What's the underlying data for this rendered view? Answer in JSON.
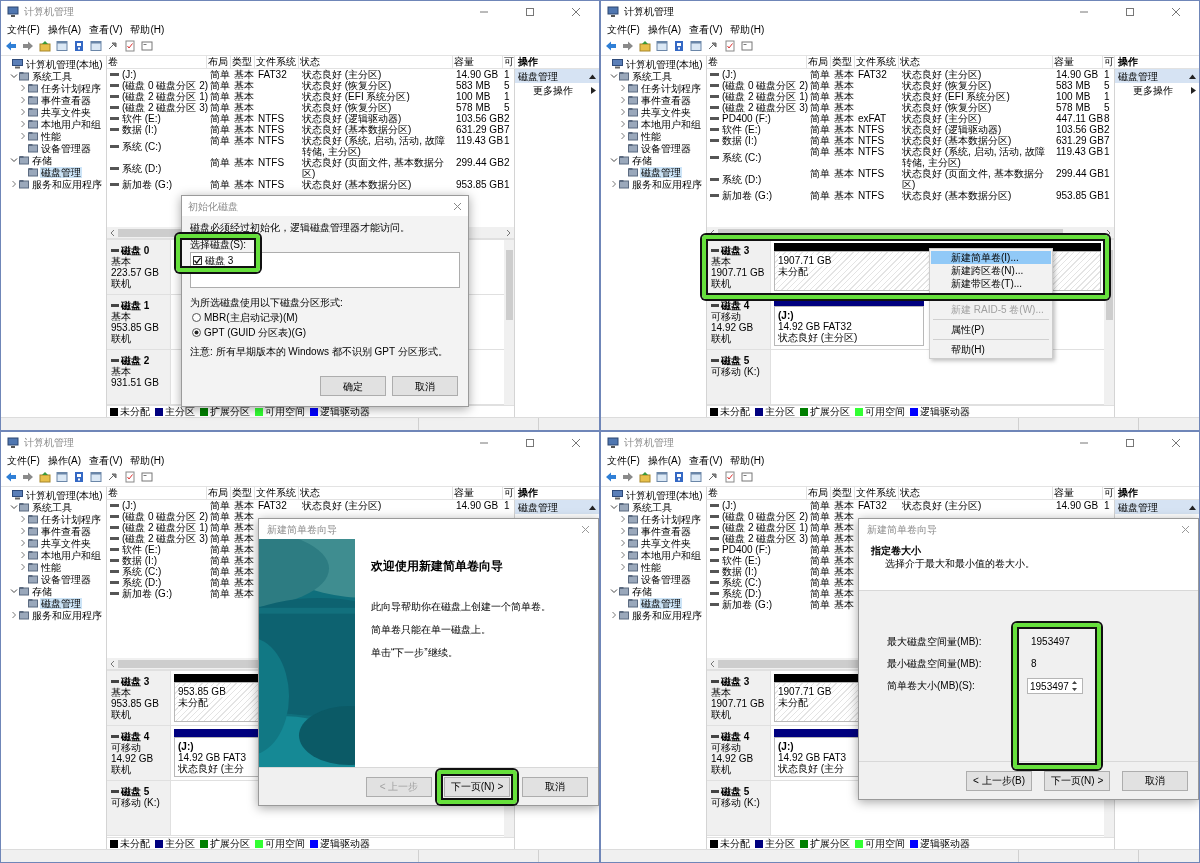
{
  "panels": [
    {
      "window": {
        "title": "计算机管理",
        "active": false
      },
      "menu": [
        "文件(F)",
        "操作(A)",
        "查看(V)",
        "帮助(H)"
      ],
      "tree": [
        {
          "label": "计算机管理(本地)",
          "selected": false,
          "children": [
            {
              "label": "系统工具",
              "expanded": true,
              "selected": false,
              "children": [
                {
                  "label": "任务计划程序",
                  "expanded": false,
                  "selected": false
                },
                {
                  "label": "事件查看器",
                  "expanded": false,
                  "selected": false
                },
                {
                  "label": "共享文件夹",
                  "expanded": false,
                  "selected": false
                },
                {
                  "label": "本地用户和组",
                  "expanded": false,
                  "selected": false
                },
                {
                  "label": "性能",
                  "expanded": false,
                  "selected": false
                },
                {
                  "label": "设备管理器",
                  "selected": false
                }
              ]
            },
            {
              "label": "存储",
              "expanded": true,
              "selected": false,
              "children": [
                {
                  "label": "磁盘管理",
                  "selected": true
                }
              ]
            },
            {
              "label": "服务和应用程序",
              "expanded": false,
              "selected": false
            }
          ]
        }
      ],
      "table": {
        "columns": [
          "卷",
          "布局",
          "类型",
          "文件系统",
          "状态",
          "容量",
          "可"
        ],
        "rows": [
          {
            "volume": "(J:)",
            "layout": "简单",
            "type": "基本",
            "file_system": "FAT32",
            "status": "状态良好 (主分区)",
            "capacity": "14.90 GB",
            "column_7": "1"
          },
          {
            "volume": "(磁盘 0 磁盘分区 2)",
            "layout": "简单",
            "type": "基本",
            "status": "状态良好 (恢复分区)",
            "capacity": "583 MB",
            "column_7": "5"
          },
          {
            "volume": "(磁盘 2 磁盘分区 1)",
            "layout": "简单",
            "type": "基本",
            "status": "状态良好 (EFI 系统分区)",
            "capacity": "100 MB",
            "column_7": "1"
          },
          {
            "volume": "(磁盘 2 磁盘分区 3)",
            "layout": "简单",
            "type": "基本",
            "status": "状态良好 (恢复分区)",
            "capacity": "578 MB",
            "column_7": "5"
          },
          {
            "volume": "软件 (E:)",
            "layout": "简单",
            "type": "基本",
            "file_system": "NTFS",
            "status": "状态良好 (逻辑驱动器)",
            "capacity": "103.56 GB",
            "column_7": "2"
          },
          {
            "volume": "数据 (I:)",
            "layout": "简单",
            "type": "基本",
            "file_system": "NTFS",
            "status": "状态良好 (基本数据分区)",
            "capacity": "631.29 GB",
            "column_7": "7"
          },
          {
            "volume": "系统 (C:)",
            "layout": "简单",
            "type": "基本",
            "file_system": "NTFS",
            "status": "状态良好 (系统, 启动, 活动, 故障转储, 主分区)",
            "capacity": "119.43 GB",
            "column_7": "1"
          },
          {
            "volume": "系统 (D:)",
            "layout": "简单",
            "type": "基本",
            "file_system": "NTFS",
            "status": "状态良好 (页面文件, 基本数据分区)",
            "capacity": "299.44 GB",
            "column_7": "2"
          },
          {
            "volume": "新加卷 (G:)",
            "layout": "简单",
            "type": "基本",
            "file_system": "NTFS",
            "status": "状态良好 (基本数据分区)",
            "capacity": "953.85 GB",
            "column_7": "1"
          }
        ]
      },
      "actions": {
        "title": "操作",
        "items": [
          {
            "label": "磁盘管理",
            "kind": "section"
          },
          {
            "label": "更多操作",
            "kind": "submenu"
          }
        ]
      },
      "disks": [
        {
          "name": "磁盘 0",
          "type": "基本",
          "size": "223.57 GB",
          "status": "联机"
        },
        {
          "name": "磁盘 1",
          "type": "基本",
          "size": "953.85 GB",
          "status": "联机"
        },
        {
          "name": "磁盘 2",
          "type": "基本",
          "size": "931.51 GB"
        }
      ],
      "legend": [
        {
          "label": "未分配",
          "color": "#000000"
        },
        {
          "label": "主分区",
          "color": "#00007f"
        },
        {
          "label": "扩展分区",
          "color": "#007f00"
        },
        {
          "label": "可用空间",
          "color": "#33ff33"
        },
        {
          "label": "逻辑驱动器",
          "color": "#0000ff"
        }
      ],
      "dialog": {
        "kind": "init_disk",
        "title": "初始化磁盘",
        "message": "磁盘必须经过初始化，逻辑磁盘管理器才能访问。",
        "disk_list_label": "选择磁盘(S):",
        "disk_list_highlighted": true,
        "disks": [
          {
            "label": "磁盘 3",
            "checked": true
          }
        ],
        "style_label": "为所选磁盘使用以下磁盘分区形式:",
        "styles": [
          {
            "label": "MBR(主启动记录)(M)",
            "selected": false
          },
          {
            "label": "GPT (GUID 分区表)(G)",
            "selected": true
          }
        ],
        "note": "注意: 所有早期版本的 Windows 都不识别 GPT 分区形式。",
        "buttons": [
          {
            "label": "确定",
            "disabled": false,
            "highlighted": false
          },
          {
            "label": "取消",
            "disabled": false,
            "highlighted": false
          }
        ]
      }
    },
    {
      "window": {
        "title": "计算机管理",
        "active": true
      },
      "menu": [
        "文件(F)",
        "操作(A)",
        "查看(V)",
        "帮助(H)"
      ],
      "tree": [
        {
          "label": "计算机管理(本地)",
          "selected": false,
          "children": [
            {
              "label": "系统工具",
              "expanded": true,
              "selected": false,
              "children": [
                {
                  "label": "任务计划程序",
                  "expanded": false,
                  "selected": false
                },
                {
                  "label": "事件查看器",
                  "expanded": false,
                  "selected": false
                },
                {
                  "label": "共享文件夹",
                  "expanded": false,
                  "selected": false
                },
                {
                  "label": "本地用户和组",
                  "expanded": false,
                  "selected": false
                },
                {
                  "label": "性能",
                  "expanded": false,
                  "selected": false
                },
                {
                  "label": "设备管理器",
                  "selected": false
                }
              ]
            },
            {
              "label": "存储",
              "expanded": true,
              "selected": false,
              "children": [
                {
                  "label": "磁盘管理",
                  "selected": true
                }
              ]
            },
            {
              "label": "服务和应用程序",
              "expanded": false,
              "selected": false
            }
          ]
        }
      ],
      "table": {
        "columns": [
          "卷",
          "布局",
          "类型",
          "文件系统",
          "状态",
          "容量",
          "可"
        ],
        "rows": [
          {
            "volume": "(J:)",
            "layout": "简单",
            "type": "基本",
            "file_system": "FAT32",
            "status": "状态良好 (主分区)",
            "capacity": "14.90 GB",
            "column_7": "1"
          },
          {
            "volume": "(磁盘 0 磁盘分区 2)",
            "layout": "简单",
            "type": "基本",
            "status": "状态良好 (恢复分区)",
            "capacity": "583 MB",
            "column_7": "5"
          },
          {
            "volume": "(磁盘 2 磁盘分区 1)",
            "layout": "简单",
            "type": "基本",
            "status": "状态良好 (EFI 系统分区)",
            "capacity": "100 MB",
            "column_7": "1"
          },
          {
            "volume": "(磁盘 2 磁盘分区 3)",
            "layout": "简单",
            "type": "基本",
            "status": "状态良好 (恢复分区)",
            "capacity": "578 MB",
            "column_7": "5"
          },
          {
            "volume": "PD400 (F:)",
            "layout": "简单",
            "type": "基本",
            "file_system": "exFAT",
            "status": "状态良好 (主分区)",
            "capacity": "447.11 GB",
            "column_7": "8"
          },
          {
            "volume": "软件 (E:)",
            "layout": "简单",
            "type": "基本",
            "file_system": "NTFS",
            "status": "状态良好 (逻辑驱动器)",
            "capacity": "103.56 GB",
            "column_7": "2"
          },
          {
            "volume": "数据 (I:)",
            "layout": "简单",
            "type": "基本",
            "file_system": "NTFS",
            "status": "状态良好 (基本数据分区)",
            "capacity": "631.29 GB",
            "column_7": "7"
          },
          {
            "volume": "系统 (C:)",
            "layout": "简单",
            "type": "基本",
            "file_system": "NTFS",
            "status": "状态良好 (系统, 启动, 活动, 故障转储, 主分区)",
            "capacity": "119.43 GB",
            "column_7": "1"
          },
          {
            "volume": "系统 (D:)",
            "layout": "简单",
            "type": "基本",
            "file_system": "NTFS",
            "status": "状态良好 (页面文件, 基本数据分区)",
            "capacity": "299.44 GB",
            "column_7": "1"
          },
          {
            "volume": "新加卷 (G:)",
            "layout": "简单",
            "type": "基本",
            "file_system": "NTFS",
            "status": "状态良好 (基本数据分区)",
            "capacity": "953.85 GB",
            "column_7": "1"
          }
        ]
      },
      "actions": {
        "title": "操作",
        "items": [
          {
            "label": "磁盘管理",
            "kind": "section"
          },
          {
            "label": "更多操作",
            "kind": "submenu"
          }
        ]
      },
      "disks": [
        {
          "name": "磁盘 3",
          "type": "基本",
          "size": "1907.71 GB",
          "status": "联机",
          "highlighted": true,
          "partitions": [
            {
              "kind": "unallocated",
              "size": "1907.71 GB",
              "status": "未分配"
            }
          ]
        },
        {
          "name": "磁盘 4",
          "type": "可移动",
          "size": "14.92 GB",
          "status": "联机",
          "highlighted": false,
          "partitions": [
            {
              "kind": "primary",
              "label": "(J:)",
              "size": "14.92 GB FAT32",
              "status": "状态良好 (主分区)"
            }
          ]
        },
        {
          "name": "磁盘 5",
          "type": "可移动 (K:)",
          "highlighted": false
        }
      ],
      "legend": [
        {
          "label": "未分配",
          "color": "#000000"
        },
        {
          "label": "主分区",
          "color": "#00007f"
        },
        {
          "label": "扩展分区",
          "color": "#007f00"
        },
        {
          "label": "可用空间",
          "color": "#33ff33"
        },
        {
          "label": "逻辑驱动器",
          "color": "#0000ff"
        }
      ],
      "dialog": {
        "kind": "context_menu",
        "groups": [
          [
            {
              "label": "新建简单卷(I)...",
              "selected": true,
              "disabled": false
            },
            {
              "label": "新建跨区卷(N)...",
              "selected": false,
              "disabled": false
            },
            {
              "label": "新建带区卷(T)...",
              "selected": false,
              "disabled": false
            },
            {
              "label": "新建 RAID-5 卷(W)...",
              "selected": false,
              "disabled": true
            }
          ],
          [
            {
              "label": "属性(P)",
              "selected": false,
              "disabled": false
            }
          ],
          [
            {
              "label": "帮助(H)",
              "selected": false,
              "disabled": false
            }
          ]
        ]
      }
    },
    {
      "window": {
        "title": "计算机管理",
        "active": false
      },
      "menu": [
        "文件(F)",
        "操作(A)",
        "查看(V)",
        "帮助(H)"
      ],
      "tree": [
        {
          "label": "计算机管理(本地)",
          "selected": false,
          "children": [
            {
              "label": "系统工具",
              "expanded": true,
              "selected": false,
              "children": [
                {
                  "label": "任务计划程序",
                  "expanded": false,
                  "selected": false
                },
                {
                  "label": "事件查看器",
                  "expanded": false,
                  "selected": false
                },
                {
                  "label": "共享文件夹",
                  "expanded": false,
                  "selected": false
                },
                {
                  "label": "本地用户和组",
                  "expanded": false,
                  "selected": false
                },
                {
                  "label": "性能",
                  "expanded": false,
                  "selected": false
                },
                {
                  "label": "设备管理器",
                  "selected": false
                }
              ]
            },
            {
              "label": "存储",
              "expanded": true,
              "selected": false,
              "children": [
                {
                  "label": "磁盘管理",
                  "selected": true
                }
              ]
            },
            {
              "label": "服务和应用程序",
              "expanded": false,
              "selected": false
            }
          ]
        }
      ],
      "table": {
        "columns": [
          "卷",
          "布局",
          "类型",
          "文件系统",
          "状态",
          "容量",
          "可"
        ],
        "rows": [
          {
            "volume": "(J:)",
            "layout": "简单",
            "type": "基本",
            "file_system": "FAT32",
            "status": "状态良好 (主分区)",
            "capacity": "14.90 GB",
            "column_7": "1"
          },
          {
            "volume": "(磁盘 0 磁盘分区 2)",
            "layout": "简单",
            "type": "基本"
          },
          {
            "volume": "(磁盘 2 磁盘分区 1)",
            "layout": "简单",
            "type": "基本"
          },
          {
            "volume": "(磁盘 2 磁盘分区 3)",
            "layout": "简单",
            "type": "基本"
          },
          {
            "volume": "软件 (E:)",
            "layout": "简单",
            "type": "基本"
          },
          {
            "volume": "数据 (I:)",
            "layout": "简单",
            "type": "基本"
          },
          {
            "volume": "系统 (C:)",
            "layout": "简单",
            "type": "基本"
          },
          {
            "volume": "系统 (D:)",
            "layout": "简单",
            "type": "基本"
          },
          {
            "volume": "新加卷 (G:)",
            "layout": "简单",
            "type": "基本"
          }
        ]
      },
      "actions": {
        "title": "操作",
        "items": [
          {
            "label": "磁盘管理",
            "kind": "section"
          }
        ]
      },
      "disks": [
        {
          "name": "磁盘 3",
          "type": "基本",
          "size": "953.85 GB",
          "status": "联机",
          "highlighted": false,
          "partitions": [
            {
              "kind": "unallocated",
              "size": "953.85 GB",
              "status": "未分配"
            }
          ]
        },
        {
          "name": "磁盘 4",
          "type": "可移动",
          "size": "14.92 GB",
          "status": "联机",
          "highlighted": false,
          "partitions": [
            {
              "kind": "primary",
              "label": "(J:)",
              "size": "14.92 GB FAT3",
              "status": "状态良好 (主分"
            }
          ]
        },
        {
          "name": "磁盘 5",
          "type": "可移动 (K:)",
          "highlighted": false
        }
      ],
      "legend": [
        {
          "label": "未分配",
          "color": "#000000"
        },
        {
          "label": "主分区",
          "color": "#00007f"
        },
        {
          "label": "扩展分区",
          "color": "#007f00"
        },
        {
          "label": "可用空间",
          "color": "#33ff33"
        },
        {
          "label": "逻辑驱动器",
          "color": "#0000ff"
        }
      ],
      "dialog": {
        "kind": "wizard_welcome",
        "title": "新建简单卷向导",
        "heading": "欢迎使用新建简单卷向导",
        "paragraphs": [
          "此向导帮助你在磁盘上创建一个简单卷。",
          "简单卷只能在单一磁盘上。",
          "单击“下一步”继续。"
        ],
        "buttons": [
          {
            "label": "< 上一步",
            "disabled": true,
            "highlighted": false
          },
          {
            "label": "下一页(N) >",
            "disabled": false,
            "highlighted": true
          },
          {
            "label": "取消",
            "disabled": false,
            "highlighted": false
          }
        ]
      }
    },
    {
      "window": {
        "title": "计算机管理",
        "active": false
      },
      "menu": [
        "文件(F)",
        "操作(A)",
        "查看(V)",
        "帮助(H)"
      ],
      "tree": [
        {
          "label": "计算机管理(本地)",
          "selected": false,
          "children": [
            {
              "label": "系统工具",
              "expanded": true,
              "selected": false,
              "children": [
                {
                  "label": "任务计划程序",
                  "expanded": false,
                  "selected": false
                },
                {
                  "label": "事件查看器",
                  "expanded": false,
                  "selected": false
                },
                {
                  "label": "共享文件夹",
                  "expanded": false,
                  "selected": false
                },
                {
                  "label": "本地用户和组",
                  "expanded": false,
                  "selected": false
                },
                {
                  "label": "性能",
                  "expanded": false,
                  "selected": false
                },
                {
                  "label": "设备管理器",
                  "selected": false
                }
              ]
            },
            {
              "label": "存储",
              "expanded": true,
              "selected": false,
              "children": [
                {
                  "label": "磁盘管理",
                  "selected": true
                }
              ]
            },
            {
              "label": "服务和应用程序",
              "expanded": false,
              "selected": false
            }
          ]
        }
      ],
      "table": {
        "columns": [
          "卷",
          "布局",
          "类型",
          "文件系统",
          "状态",
          "容量",
          "可"
        ],
        "rows": [
          {
            "volume": "(J:)",
            "layout": "简单",
            "type": "基本",
            "file_system": "FAT32",
            "status": "状态良好 (主分区)",
            "capacity": "14.90 GB",
            "column_7": "1"
          },
          {
            "volume": "(磁盘 0 磁盘分区 2)",
            "layout": "简单",
            "type": "基本"
          },
          {
            "volume": "(磁盘 2 磁盘分区 1)",
            "layout": "简单",
            "type": "基本"
          },
          {
            "volume": "(磁盘 2 磁盘分区 3)",
            "layout": "简单",
            "type": "基本"
          },
          {
            "volume": "PD400 (F:)",
            "layout": "简单",
            "type": "基本"
          },
          {
            "volume": "软件 (E:)",
            "layout": "简单",
            "type": "基本"
          },
          {
            "volume": "数据 (I:)",
            "layout": "简单",
            "type": "基本"
          },
          {
            "volume": "系统 (C:)",
            "layout": "简单",
            "type": "基本"
          },
          {
            "volume": "系统 (D:)",
            "layout": "简单",
            "type": "基本"
          },
          {
            "volume": "新加卷 (G:)",
            "layout": "简单",
            "type": "基本"
          }
        ]
      },
      "actions": {
        "title": "操作",
        "items": [
          {
            "label": "磁盘管理",
            "kind": "section"
          }
        ]
      },
      "disks": [
        {
          "name": "磁盘 3",
          "type": "基本",
          "size": "1907.71 GB",
          "status": "联机",
          "highlighted": false,
          "partitions": [
            {
              "kind": "unallocated",
              "size": "1907.71 GB",
              "status": "未分配"
            }
          ]
        },
        {
          "name": "磁盘 4",
          "type": "可移动",
          "size": "14.92 GB",
          "status": "联机",
          "highlighted": false,
          "partitions": [
            {
              "kind": "primary",
              "label": "(J:)",
              "size": "14.92 GB FAT3",
              "status": "状态良好 (主分"
            }
          ]
        },
        {
          "name": "磁盘 5",
          "type": "可移动 (K:)",
          "highlighted": false
        }
      ],
      "legend": [
        {
          "label": "未分配",
          "color": "#000000"
        },
        {
          "label": "主分区",
          "color": "#00007f"
        },
        {
          "label": "扩展分区",
          "color": "#007f00"
        },
        {
          "label": "可用空间",
          "color": "#33ff33"
        },
        {
          "label": "逻辑驱动器",
          "color": "#0000ff"
        }
      ],
      "dialog": {
        "kind": "wizard_size",
        "title": "新建简单卷向导",
        "heading": "指定卷大小",
        "subheading": "选择介于最大和最小值的卷大小。",
        "values_highlighted": true,
        "fields": [
          {
            "label": "最大磁盘空间量(MB):",
            "value": "1953497",
            "kind": "text"
          },
          {
            "label": "最小磁盘空间量(MB):",
            "value": "8",
            "kind": "text"
          },
          {
            "label": "简单卷大小(MB)(S):",
            "value": "1953497",
            "kind": "spinner"
          }
        ],
        "buttons": [
          {
            "label": "< 上一步(B)",
            "disabled": false,
            "highlighted": false
          },
          {
            "label": "下一页(N) >",
            "disabled": false,
            "highlighted": false
          },
          {
            "label": "取消",
            "disabled": false,
            "highlighted": false
          }
        ]
      }
    }
  ]
}
